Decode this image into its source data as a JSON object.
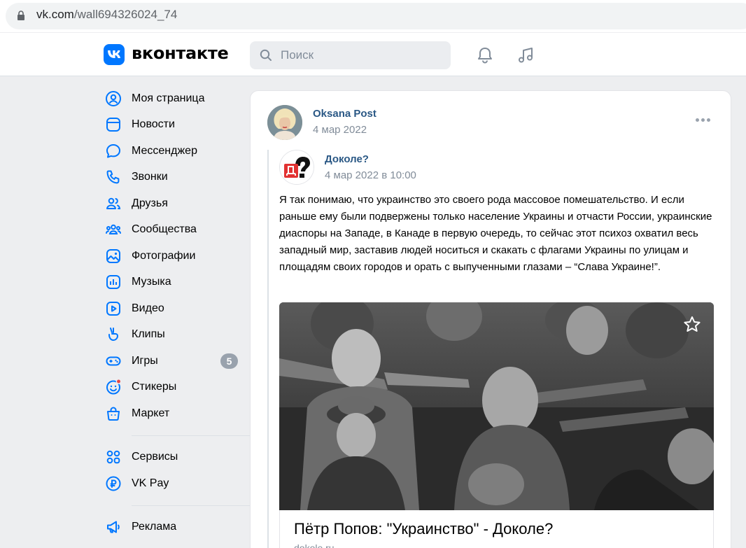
{
  "browser": {
    "url_host": "vk.com",
    "url_path": "/wall694326024_74"
  },
  "header": {
    "brand": "вконтакте",
    "search_placeholder": "Поиск",
    "accent": "#0077ff"
  },
  "sidebar": {
    "items": [
      {
        "label": "Моя страница",
        "icon": "user-circle-icon"
      },
      {
        "label": "Новости",
        "icon": "news-icon"
      },
      {
        "label": "Мессенджер",
        "icon": "message-icon"
      },
      {
        "label": "Звонки",
        "icon": "phone-icon"
      },
      {
        "label": "Друзья",
        "icon": "friends-icon"
      },
      {
        "label": "Сообщества",
        "icon": "communities-icon"
      },
      {
        "label": "Фотографии",
        "icon": "photo-icon"
      },
      {
        "label": "Музыка",
        "icon": "music-icon"
      },
      {
        "label": "Видео",
        "icon": "video-icon"
      },
      {
        "label": "Клипы",
        "icon": "clips-icon"
      },
      {
        "label": "Игры",
        "icon": "games-icon",
        "badge": "5"
      },
      {
        "label": "Стикеры",
        "icon": "stickers-icon"
      },
      {
        "label": "Маркет",
        "icon": "market-icon"
      }
    ],
    "items2": [
      {
        "label": "Сервисы",
        "icon": "services-icon"
      },
      {
        "label": "VK Pay",
        "icon": "vkpay-icon"
      }
    ],
    "items3": [
      {
        "label": "Реклама",
        "icon": "ads-icon"
      }
    ]
  },
  "post": {
    "author": "Oksana Post",
    "date": "4 мар 2022",
    "repost": {
      "author": "Доколе?",
      "date": "4 мар 2022 в 10:00",
      "text": "Я так понимаю, что украинство это своего рода массовое помешательство. И если раньше ему были подвержены только население Украины и отчасти России, украинские диаспоры на Западе, в Канаде в первую очередь, то сейчас этот психоз охватил весь западный мир, заставив людей носиться и скакать с флагами Украины по улицам и площадям своих городов и орать с выпученными глазами – “Слава Украине!”.",
      "link_title": "Пётр Попов: \"Украинство\" - Доколе?",
      "link_domain": "dokole.ru"
    }
  }
}
